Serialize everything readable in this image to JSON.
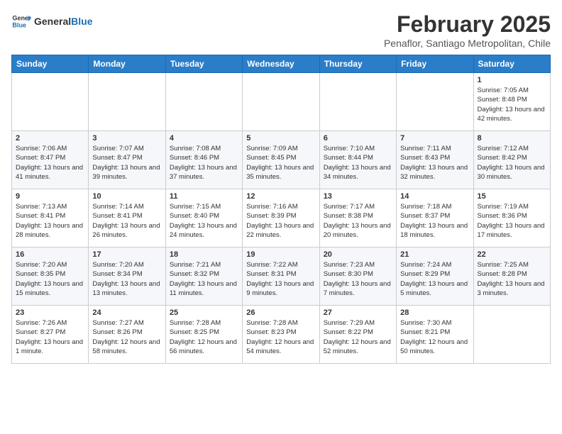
{
  "header": {
    "logo_line1": "General",
    "logo_line2": "Blue",
    "month_year": "February 2025",
    "location": "Penaflor, Santiago Metropolitan, Chile"
  },
  "weekdays": [
    "Sunday",
    "Monday",
    "Tuesday",
    "Wednesday",
    "Thursday",
    "Friday",
    "Saturday"
  ],
  "weeks": [
    [
      {
        "day": "",
        "info": ""
      },
      {
        "day": "",
        "info": ""
      },
      {
        "day": "",
        "info": ""
      },
      {
        "day": "",
        "info": ""
      },
      {
        "day": "",
        "info": ""
      },
      {
        "day": "",
        "info": ""
      },
      {
        "day": "1",
        "info": "Sunrise: 7:05 AM\nSunset: 8:48 PM\nDaylight: 13 hours and 42 minutes."
      }
    ],
    [
      {
        "day": "2",
        "info": "Sunrise: 7:06 AM\nSunset: 8:47 PM\nDaylight: 13 hours and 41 minutes."
      },
      {
        "day": "3",
        "info": "Sunrise: 7:07 AM\nSunset: 8:47 PM\nDaylight: 13 hours and 39 minutes."
      },
      {
        "day": "4",
        "info": "Sunrise: 7:08 AM\nSunset: 8:46 PM\nDaylight: 13 hours and 37 minutes."
      },
      {
        "day": "5",
        "info": "Sunrise: 7:09 AM\nSunset: 8:45 PM\nDaylight: 13 hours and 35 minutes."
      },
      {
        "day": "6",
        "info": "Sunrise: 7:10 AM\nSunset: 8:44 PM\nDaylight: 13 hours and 34 minutes."
      },
      {
        "day": "7",
        "info": "Sunrise: 7:11 AM\nSunset: 8:43 PM\nDaylight: 13 hours and 32 minutes."
      },
      {
        "day": "8",
        "info": "Sunrise: 7:12 AM\nSunset: 8:42 PM\nDaylight: 13 hours and 30 minutes."
      }
    ],
    [
      {
        "day": "9",
        "info": "Sunrise: 7:13 AM\nSunset: 8:41 PM\nDaylight: 13 hours and 28 minutes."
      },
      {
        "day": "10",
        "info": "Sunrise: 7:14 AM\nSunset: 8:41 PM\nDaylight: 13 hours and 26 minutes."
      },
      {
        "day": "11",
        "info": "Sunrise: 7:15 AM\nSunset: 8:40 PM\nDaylight: 13 hours and 24 minutes."
      },
      {
        "day": "12",
        "info": "Sunrise: 7:16 AM\nSunset: 8:39 PM\nDaylight: 13 hours and 22 minutes."
      },
      {
        "day": "13",
        "info": "Sunrise: 7:17 AM\nSunset: 8:38 PM\nDaylight: 13 hours and 20 minutes."
      },
      {
        "day": "14",
        "info": "Sunrise: 7:18 AM\nSunset: 8:37 PM\nDaylight: 13 hours and 18 minutes."
      },
      {
        "day": "15",
        "info": "Sunrise: 7:19 AM\nSunset: 8:36 PM\nDaylight: 13 hours and 17 minutes."
      }
    ],
    [
      {
        "day": "16",
        "info": "Sunrise: 7:20 AM\nSunset: 8:35 PM\nDaylight: 13 hours and 15 minutes."
      },
      {
        "day": "17",
        "info": "Sunrise: 7:20 AM\nSunset: 8:34 PM\nDaylight: 13 hours and 13 minutes."
      },
      {
        "day": "18",
        "info": "Sunrise: 7:21 AM\nSunset: 8:32 PM\nDaylight: 13 hours and 11 minutes."
      },
      {
        "day": "19",
        "info": "Sunrise: 7:22 AM\nSunset: 8:31 PM\nDaylight: 13 hours and 9 minutes."
      },
      {
        "day": "20",
        "info": "Sunrise: 7:23 AM\nSunset: 8:30 PM\nDaylight: 13 hours and 7 minutes."
      },
      {
        "day": "21",
        "info": "Sunrise: 7:24 AM\nSunset: 8:29 PM\nDaylight: 13 hours and 5 minutes."
      },
      {
        "day": "22",
        "info": "Sunrise: 7:25 AM\nSunset: 8:28 PM\nDaylight: 13 hours and 3 minutes."
      }
    ],
    [
      {
        "day": "23",
        "info": "Sunrise: 7:26 AM\nSunset: 8:27 PM\nDaylight: 13 hours and 1 minute."
      },
      {
        "day": "24",
        "info": "Sunrise: 7:27 AM\nSunset: 8:26 PM\nDaylight: 12 hours and 58 minutes."
      },
      {
        "day": "25",
        "info": "Sunrise: 7:28 AM\nSunset: 8:25 PM\nDaylight: 12 hours and 56 minutes."
      },
      {
        "day": "26",
        "info": "Sunrise: 7:28 AM\nSunset: 8:23 PM\nDaylight: 12 hours and 54 minutes."
      },
      {
        "day": "27",
        "info": "Sunrise: 7:29 AM\nSunset: 8:22 PM\nDaylight: 12 hours and 52 minutes."
      },
      {
        "day": "28",
        "info": "Sunrise: 7:30 AM\nSunset: 8:21 PM\nDaylight: 12 hours and 50 minutes."
      },
      {
        "day": "",
        "info": ""
      }
    ]
  ]
}
